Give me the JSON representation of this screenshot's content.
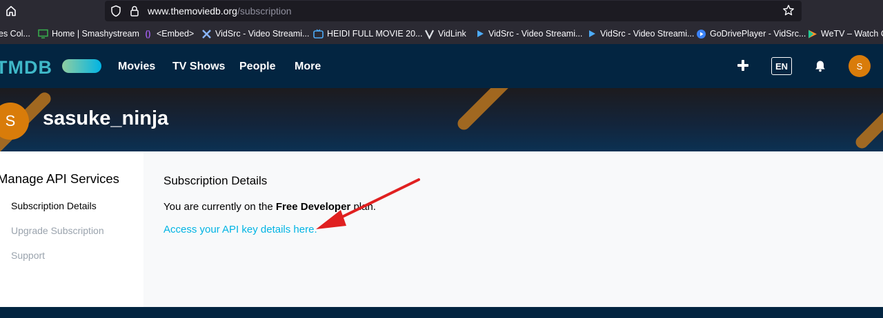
{
  "browser": {
    "url_host": "www.themoviedb.org",
    "url_path": "/subscription"
  },
  "bookmarks": [
    {
      "label": "es Col...",
      "icon": "partial-icon"
    },
    {
      "label": "Home | Smashystream",
      "icon": "monitor-icon"
    },
    {
      "label": "<Embed>",
      "icon": "embed-icon"
    },
    {
      "label": "VidSrc - Video Streami...",
      "icon": "vidsrc-x-icon"
    },
    {
      "label": "HEIDI FULL MOVIE 20...",
      "icon": "tv-icon"
    },
    {
      "label": "VidLink",
      "icon": "vidlink-v-icon"
    },
    {
      "label": "VidSrc - Video Streami...",
      "icon": "play-icon"
    },
    {
      "label": "VidSrc - Video Streami...",
      "icon": "play-icon"
    },
    {
      "label": "GoDrivePlayer - VidSrc...",
      "icon": "godrive-icon"
    },
    {
      "label": "WeTV – Watch Cl",
      "icon": "wetv-icon"
    }
  ],
  "header": {
    "logo": "TMDB",
    "nav": [
      "Movies",
      "TV Shows",
      "People",
      "More"
    ],
    "lang": "EN",
    "avatar_letter": "S"
  },
  "profile": {
    "avatar_letter": "S",
    "username": "sasuke_ninja"
  },
  "sidebar": {
    "title": "Manage API Services",
    "links": [
      "Subscription Details",
      "Upgrade Subscription",
      "Support"
    ]
  },
  "main": {
    "title": "Subscription Details",
    "plan_prefix": "You are currently on the ",
    "plan_name": "Free Developer",
    "plan_suffix": " plan.",
    "api_link": "Access your API key details here."
  },
  "colors": {
    "tmdb_navy": "#032541",
    "tmdb_light_blue": "#01b4e4",
    "avatar_orange": "#d97c0a",
    "annotation_arrow": "#e02020"
  }
}
